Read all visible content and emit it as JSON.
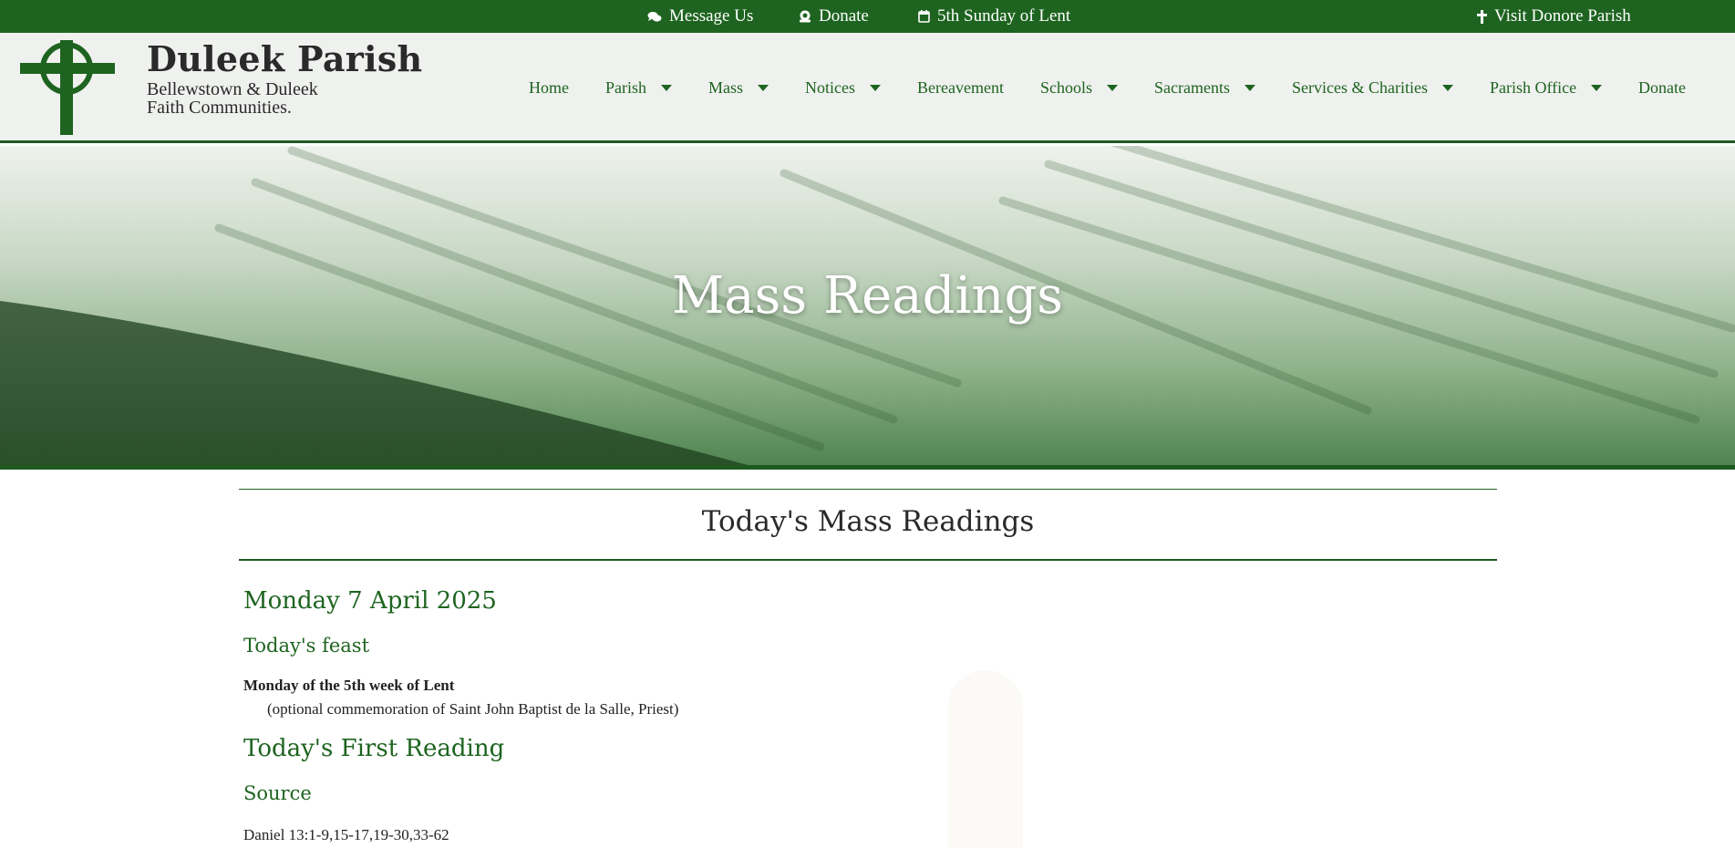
{
  "topbar": {
    "message": "Message Us",
    "donate": "Donate",
    "sunday": "5th Sunday of Lent",
    "visit": "Visit Donore Parish"
  },
  "brand": {
    "title": "Duleek Parish",
    "sub1": "Bellewstown & Duleek",
    "sub2": "Faith Communities."
  },
  "nav": {
    "home": "Home",
    "parish": "Parish",
    "mass": "Mass",
    "notices": "Notices",
    "bereavement": "Bereavement",
    "schools": "Schools",
    "sacraments": "Sacraments",
    "services": "Services & Charities",
    "office": "Parish Office",
    "donate": "Donate"
  },
  "hero": {
    "title": "Mass Readings"
  },
  "main": {
    "heading": "Today's Mass Readings",
    "date": "Monday 7 April 2025",
    "feast_heading": "Today's feast",
    "feast_name": "Monday of the 5th week of Lent",
    "feast_note": "(optional commemoration of Saint John Baptist de la Salle, Priest)",
    "first_reading_heading": "Today's First Reading",
    "source_heading": "Source",
    "source_text": "Daniel 13:1-9,15-17,19-30,33-62"
  },
  "colors": {
    "brand_green": "#1e6420",
    "header_bg": "#eff1ee"
  }
}
